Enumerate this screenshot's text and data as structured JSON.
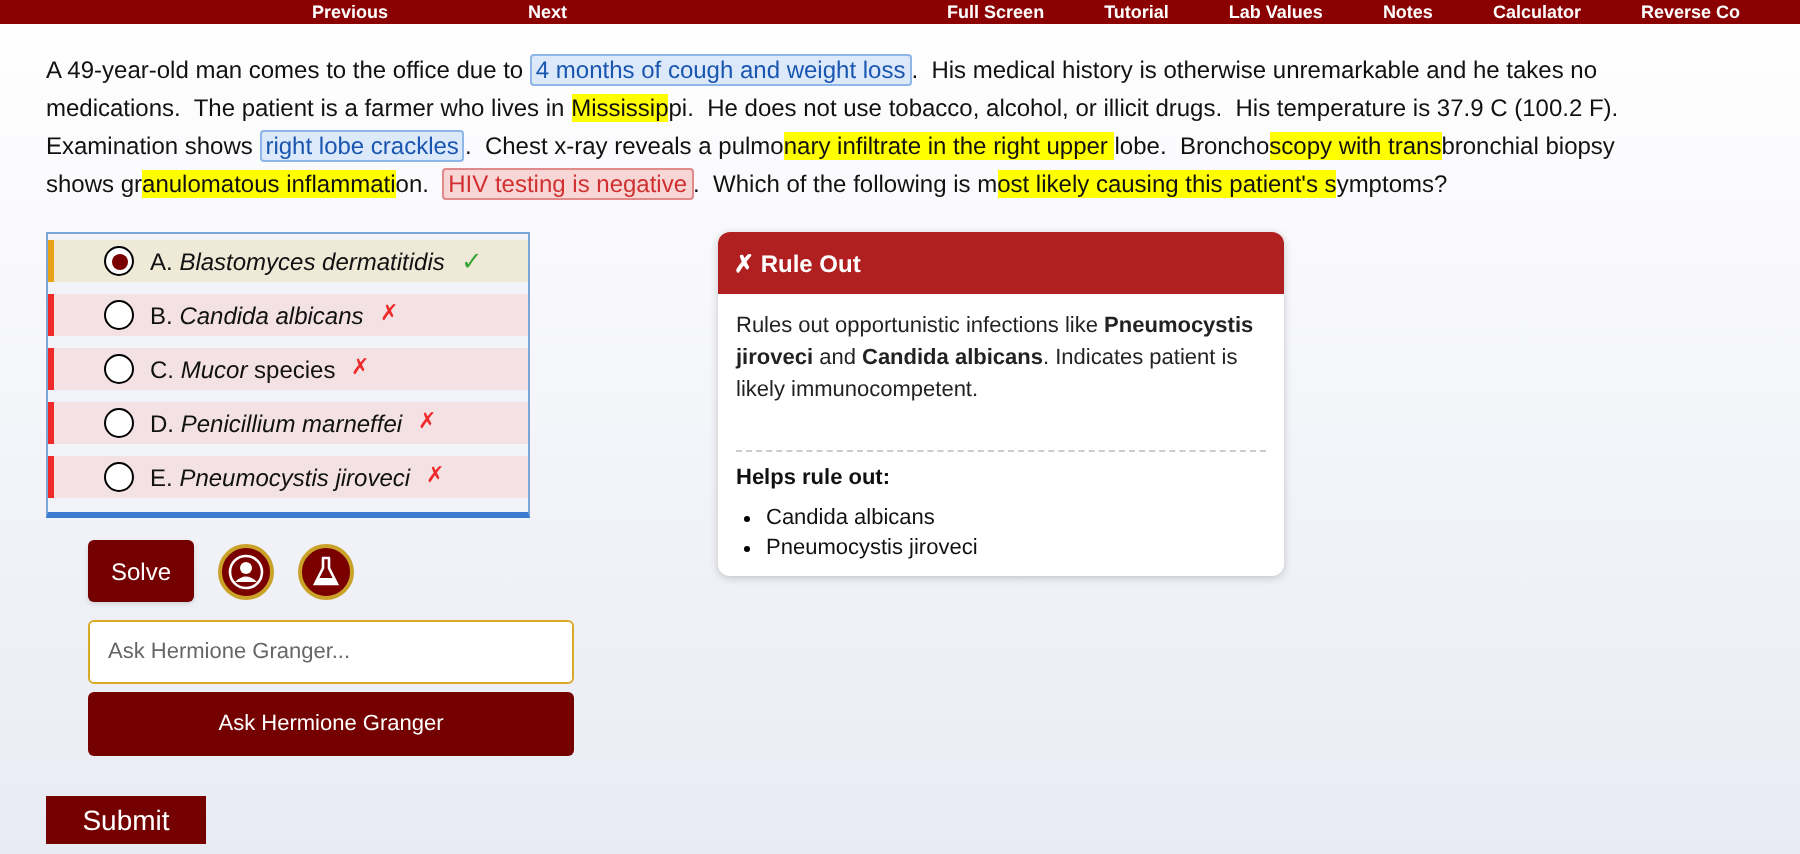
{
  "top_bar": {
    "items": [
      "Previous",
      "Next",
      "Full Screen",
      "Tutorial",
      "Lab Values",
      "Notes",
      "Calculator",
      "Reverse Co"
    ]
  },
  "passage": [
    {
      "kind": "plain",
      "text": "A 49-year-old man comes to the office due to "
    },
    {
      "kind": "finding",
      "text": "4 months of cough and weight loss"
    },
    {
      "kind": "plain",
      "text": ".  His medical history is otherwise unremarkable and he takes no medications.  The patient is a farmer who lives in "
    },
    {
      "kind": "highlight",
      "text": "Mississip"
    },
    {
      "kind": "plain",
      "text": "pi.  He does not use tobacco, alcohol, or illicit drugs.  His temperature is 37.9 C (100.2 F).  Examination shows "
    },
    {
      "kind": "finding",
      "text": "right lobe crackles"
    },
    {
      "kind": "plain",
      "text": ".  Chest x-ray reveals a pulmo"
    },
    {
      "kind": "highlight",
      "text": "nary infiltrate in the right upper "
    },
    {
      "kind": "plain",
      "text": "lobe.  Broncho"
    },
    {
      "kind": "highlight",
      "text": "scopy with trans"
    },
    {
      "kind": "plain",
      "text": "bronchial biopsy shows gr"
    },
    {
      "kind": "highlight",
      "text": "anulomatous inflammati"
    },
    {
      "kind": "plain",
      "text": "on.  "
    },
    {
      "kind": "negative",
      "text": "HIV testing is negative"
    },
    {
      "kind": "plain",
      "text": ".  Which of the following is m"
    },
    {
      "kind": "highlight",
      "text": "ost likely causing this patient's s"
    },
    {
      "kind": "plain",
      "text": "ymptoms?"
    }
  ],
  "choices": [
    {
      "letter": "A.",
      "text": "*Blastomyces dermatitidis*",
      "selected": true,
      "correct": true,
      "mark": "✓"
    },
    {
      "letter": "B.",
      "text": "*Candida albicans*",
      "selected": false,
      "correct": false,
      "mark": "✗"
    },
    {
      "letter": "C.",
      "text": "*Mucor* species",
      "selected": false,
      "correct": false,
      "mark": "✗"
    },
    {
      "letter": "D.",
      "text": "*Penicillium marneffei*",
      "selected": false,
      "correct": false,
      "mark": "✗"
    },
    {
      "letter": "E.",
      "text": "*Pneumocystis jiroveci*",
      "selected": false,
      "correct": false,
      "mark": "✗"
    }
  ],
  "explanation": {
    "title": "✗ Rule Out",
    "body": "Rules out opportunistic infections like **Pneumocystis jiroveci** and **Candida albicans**. Indicates patient is likely immunocompetent.",
    "list_title": "Helps rule out:",
    "list": [
      "Candida albicans",
      "Pneumocystis jiroveci"
    ]
  },
  "solve_button": "Solve",
  "ask": {
    "placeholder": "Ask Hermione Granger...",
    "button": "Ask Hermione Granger"
  },
  "submit_button": "Submit"
}
